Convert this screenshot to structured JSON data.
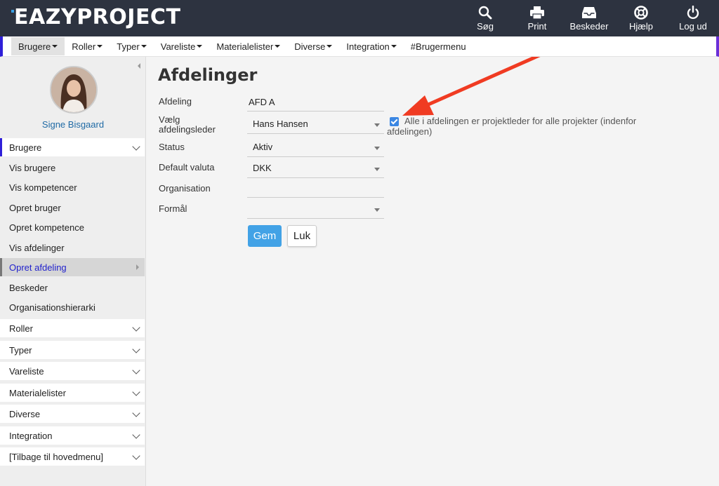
{
  "app": {
    "logo_text": "EAZYPROJECT"
  },
  "topbar": {
    "actions": [
      {
        "label": "Søg",
        "icon": "search-icon"
      },
      {
        "label": "Print",
        "icon": "printer-icon"
      },
      {
        "label": "Beskeder",
        "icon": "inbox-icon"
      },
      {
        "label": "Hjælp",
        "icon": "lifebuoy-icon"
      },
      {
        "label": "Log ud",
        "icon": "power-icon"
      }
    ]
  },
  "nav": {
    "items": [
      "Brugere",
      "Roller",
      "Typer",
      "Vareliste",
      "Materialelister",
      "Diverse",
      "Integration",
      "#Brugermenu"
    ]
  },
  "sidebar": {
    "user_name": "Signe Bisgaard",
    "open_section": "Brugere",
    "sub_items": [
      "Vis brugere",
      "Vis kompetencer",
      "Opret bruger",
      "Opret kompetence",
      "Vis afdelinger",
      "Opret afdeling",
      "Beskeder",
      "Organisationshierarki"
    ],
    "active_item": "Opret afdeling",
    "sections": [
      "Roller",
      "Typer",
      "Vareliste",
      "Materialelister",
      "Diverse",
      "Integration",
      "[Tilbage til hovedmenu]"
    ]
  },
  "main": {
    "title": "Afdelinger",
    "form": {
      "afdeling_label": "Afdeling",
      "afdeling_value": "AFD A",
      "leder_label": "Vælg afdelingsleder",
      "leder_value": "Hans Hansen",
      "status_label": "Status",
      "status_value": "Aktiv",
      "valuta_label": "Default valuta",
      "valuta_value": "DKK",
      "org_label": "Organisation",
      "org_value": "",
      "formaal_label": "Formål",
      "formaal_value": "",
      "checkbox_checked": true,
      "checkbox_label": "Alle i afdelingen er projektleder for alle projekter (indenfor afdelingen)"
    },
    "buttons": {
      "save": "Gem",
      "close": "Luk"
    }
  },
  "colors": {
    "topbar_bg": "#2d3340",
    "accent_blue": "#42a2e6",
    "nav_left_border": "#2f1fd8",
    "annotation_arrow": "#f03b22"
  }
}
